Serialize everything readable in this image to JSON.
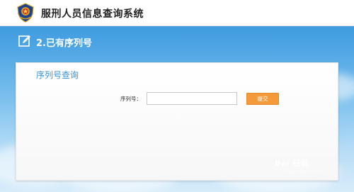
{
  "header": {
    "title": "服刑人员信息查询系统",
    "emblem_icon": "police-emblem-icon"
  },
  "section": {
    "title": "2.已有序列号",
    "icon": "edit-icon"
  },
  "panel": {
    "title": "序列号查询",
    "serial_label": "序列号：",
    "serial_value": "",
    "submit_label": "提交"
  },
  "watermark": {
    "text": "Bai 经验",
    "sub": "jingyan.baidu.com"
  },
  "colors": {
    "accent": "#3b93d5",
    "button": "#f59a3a",
    "sky_top": "#2f8fd6"
  }
}
